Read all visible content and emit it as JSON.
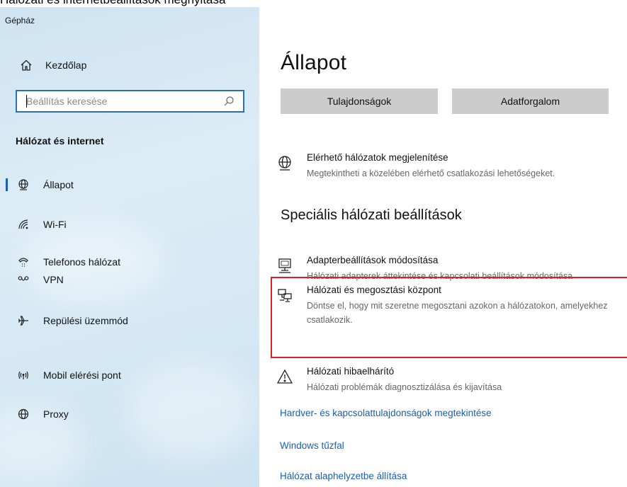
{
  "top_caption": "Hálózati és internetbeállítások megnyitása",
  "sidebar": {
    "app_title": "Gépház",
    "home_label": "Kezdőlap",
    "search_placeholder": "Beállítás keresése",
    "section_title": "Hálózat és internet",
    "items": [
      {
        "label": "Állapot",
        "icon": "globe-icon",
        "selected": true
      },
      {
        "label": "Wi-Fi",
        "icon": "wifi-icon"
      },
      {
        "label": "Telefonos hálózat",
        "icon": "phone-icon"
      },
      {
        "label": "VPN",
        "icon": "vpn-icon"
      },
      {
        "label": "Repülési üzemmód",
        "icon": "airplane-icon"
      },
      {
        "label": "Mobil elérési pont",
        "icon": "hotspot-icon"
      },
      {
        "label": "Proxy",
        "icon": "globe-icon"
      }
    ]
  },
  "main": {
    "title": "Állapot",
    "buttons": [
      "Tulajdonságok",
      "Adatforgalom"
    ],
    "available_networks": {
      "title": "Elérhető hálózatok megjelenítése",
      "desc": "Megtekintheti a közelében elérhető csatlakozási lehetőségeket."
    },
    "advanced_title": "Speciális hálózati beállítások",
    "adapter": {
      "title": "Adapterbeállítások módosítása",
      "desc": "Hálózati adapterek áttekintése és kapcsolati beállítások módosítása"
    },
    "sharing_center": {
      "title": "Hálózati és megosztási központ",
      "desc": "Döntse el, hogy mit szeretne megosztani azokon a hálózatokon, amelyekhez csatlakozik."
    },
    "troubleshooter": {
      "title": "Hálózati hibaelhárító",
      "desc": "Hálózati problémák diagnosztizálása és kijavítása"
    },
    "links": [
      "Hardver- és kapcsolattulajdonságok megtekintése",
      "Windows tűzfal",
      "Hálózat alaphelyzetbe állítása"
    ]
  },
  "colors": {
    "accent": "#1a5fb4",
    "highlight": "#e02020",
    "button_bg": "#cccccc"
  }
}
